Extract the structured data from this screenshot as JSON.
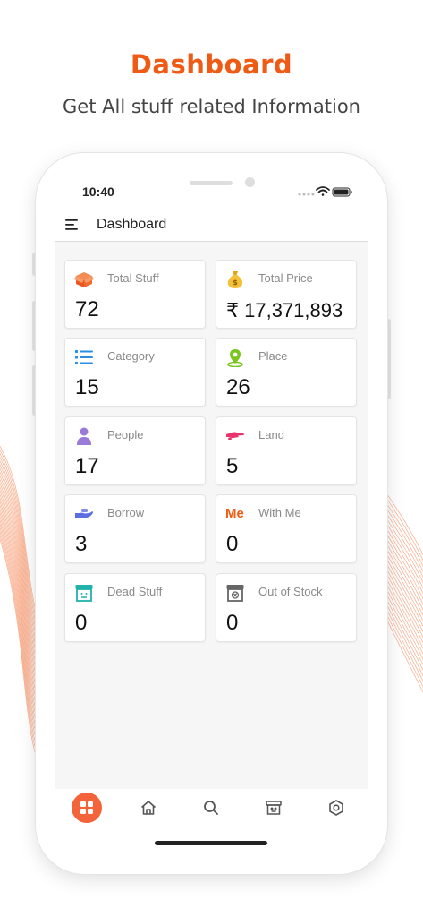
{
  "promo": {
    "title": "Dashboard",
    "subtitle": "Get All stuff related Information"
  },
  "status_bar": {
    "time": "10:40",
    "icons": [
      "signal-dots-icon",
      "wifi-icon",
      "battery-icon"
    ]
  },
  "app_bar": {
    "title": "Dashboard",
    "menu_icon": "hamburger-menu-icon"
  },
  "cards": [
    {
      "label": "Total Stuff",
      "value": "72",
      "icon": "box-icon",
      "color": "#f06a2c"
    },
    {
      "label": "Total Price",
      "value": "₹ 17,371,893",
      "icon": "money-bag-icon",
      "color": "#f2b51b"
    },
    {
      "label": "Category",
      "value": "15",
      "icon": "list-icon",
      "color": "#2a8fe3"
    },
    {
      "label": "Place",
      "value": "26",
      "icon": "location-pin-icon",
      "color": "#7cc420"
    },
    {
      "label": "People",
      "value": "17",
      "icon": "person-icon",
      "color": "#9b7bd8"
    },
    {
      "label": "Land",
      "value": "5",
      "icon": "hand-give-icon",
      "color": "#e8336d"
    },
    {
      "label": "Borrow",
      "value": "3",
      "icon": "hand-receive-icon",
      "color": "#5b6fe0"
    },
    {
      "label": "With Me",
      "value": "0",
      "icon": "me-text-icon",
      "icon_text": "Me",
      "color": "#ef5a14"
    },
    {
      "label": "Dead Stuff",
      "value": "0",
      "icon": "archive-box-icon",
      "color": "#20b2aa"
    },
    {
      "label": "Out of Stock",
      "value": "0",
      "icon": "empty-box-icon",
      "color": "#666666"
    }
  ],
  "bottom_nav": [
    {
      "icon": "grid-icon",
      "active": true,
      "color": "#f4643a"
    },
    {
      "icon": "home-icon",
      "active": false
    },
    {
      "icon": "search-icon",
      "active": false
    },
    {
      "icon": "archive-icon",
      "active": false
    },
    {
      "icon": "settings-icon",
      "active": false
    }
  ]
}
